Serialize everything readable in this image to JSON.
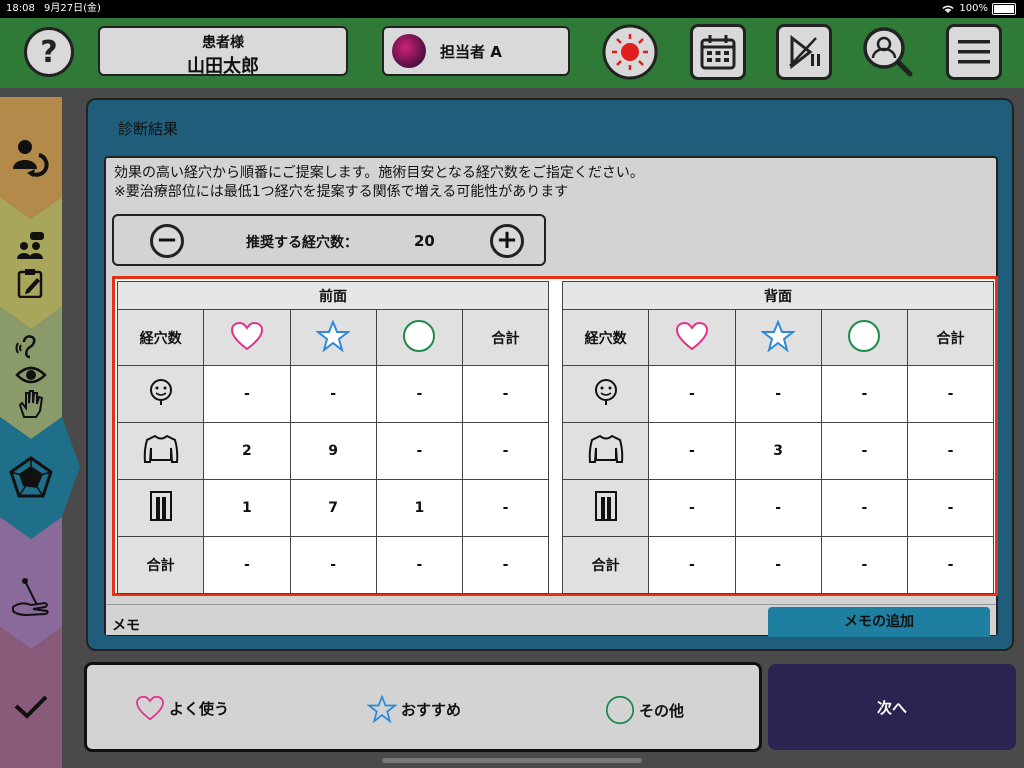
{
  "status_bar": {
    "time": "18:08",
    "date": "9月27日(金)",
    "battery": "100%"
  },
  "header": {
    "help_label": "?",
    "patient_label": "患者様",
    "patient_name": "山田太郎",
    "staff_name": "担当者 A"
  },
  "panel": {
    "title": "診断結果",
    "description_1": "効果の高い経穴から順番にご提案します。施術目安となる経穴数をご指定ください。",
    "description_2": "※要治療部位には最低1つ経穴を提案する関係で増える可能性があります",
    "stepper": {
      "label": "推奨する経穴数：",
      "value": "20",
      "minus": "−",
      "plus": "+"
    },
    "front": {
      "title": "前面",
      "header_first": "経穴数",
      "header_total": "合計",
      "rows": [
        {
          "cells": [
            "-",
            "-",
            "-",
            "-"
          ]
        },
        {
          "cells": [
            "2",
            "9",
            "-",
            "-"
          ]
        },
        {
          "cells": [
            "1",
            "7",
            "1",
            "-"
          ]
        },
        {
          "label": "合計",
          "cells": [
            "-",
            "-",
            "-",
            "-"
          ]
        }
      ]
    },
    "back": {
      "title": "背面",
      "header_first": "経穴数",
      "header_total": "合計",
      "rows": [
        {
          "cells": [
            "-",
            "-",
            "-",
            "-"
          ]
        },
        {
          "cells": [
            "-",
            "3",
            "-",
            "-"
          ]
        },
        {
          "cells": [
            "-",
            "-",
            "-",
            "-"
          ]
        },
        {
          "label": "合計",
          "cells": [
            "-",
            "-",
            "-",
            "-"
          ]
        }
      ]
    },
    "memo_label": "メモ",
    "memo_add": "メモの追加"
  },
  "legend": {
    "favorite": "よく使う",
    "recommended": "おすすめ",
    "other": "その他"
  },
  "next_label": "次へ",
  "colors": {
    "heart": "#e0308a",
    "star": "#2e8ad8",
    "circle": "#1e8a4a",
    "header_green": "#2e7a36",
    "panel_blue": "#1f5d7a",
    "next": "#2a2550",
    "highlight": "#e63214"
  },
  "icons": [
    "help-icon",
    "light-icon",
    "calendar-icon",
    "play-pause-icon",
    "search-user-icon",
    "menu-icon",
    "heart-icon",
    "star-icon",
    "circle-icon",
    "face-icon",
    "torso-icon",
    "legs-icon"
  ]
}
